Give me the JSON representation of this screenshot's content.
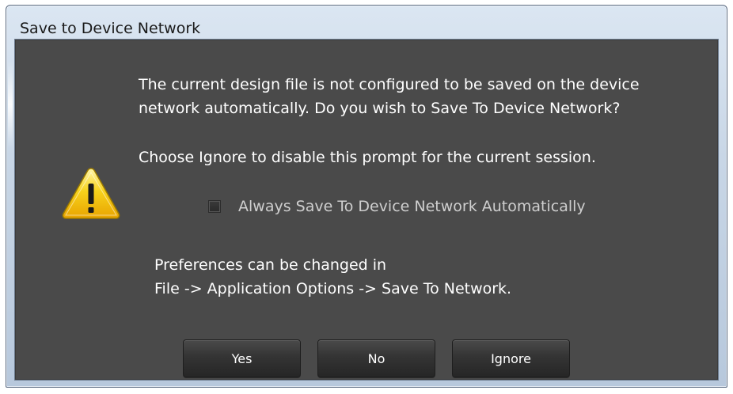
{
  "window": {
    "title": "Save to Device Network"
  },
  "message": {
    "line1": "The current design file is not configured to be saved on the device",
    "line2": "network automatically. Do you wish to Save To Device Network?",
    "line3": "Choose Ignore to disable this prompt for the current session."
  },
  "checkbox": {
    "label": "Always Save To Device Network Automatically",
    "checked": false
  },
  "preferences": {
    "line1": "Preferences can be changed in",
    "line2": "File -> Application Options -> Save To Network."
  },
  "buttons": {
    "yes": "Yes",
    "no": "No",
    "ignore": "Ignore"
  },
  "icons": {
    "warning": "warning-icon"
  },
  "colors": {
    "dialog_background": "#4a4a4a",
    "warning_yellow": "#f5c400",
    "text": "#ffffff"
  }
}
